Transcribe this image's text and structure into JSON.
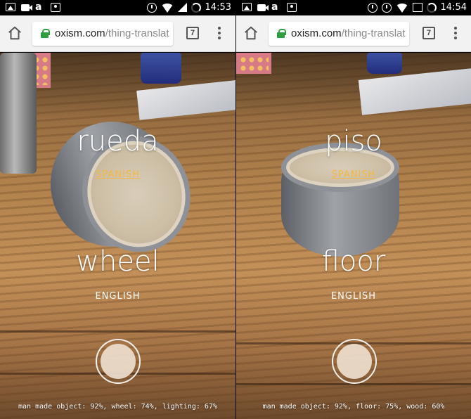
{
  "screens": [
    {
      "status": {
        "time": "14:53"
      },
      "browser": {
        "url_host": "oxism.com",
        "url_path": "/thing-translat",
        "tab_count": "7"
      },
      "translation": {
        "word": "rueda",
        "language": "SPANISH"
      },
      "source": {
        "word": "wheel",
        "language": "ENGLISH"
      },
      "predictions": "man made object: 92%, wheel: 74%, lighting: 67%"
    },
    {
      "status": {
        "time": "14:54"
      },
      "browser": {
        "url_host": "oxism.com",
        "url_path": "/thing-translat",
        "tab_count": "7"
      },
      "translation": {
        "word": "piso",
        "language": "SPANISH"
      },
      "source": {
        "word": "floor",
        "language": "ENGLISH"
      },
      "predictions": "man made object: 92%, floor: 75%, wood: 60%"
    }
  ],
  "colors": {
    "accent_language": "#f4b840",
    "lock": "#2e9e3e",
    "toolbar": "#f2f2f2"
  },
  "icons": [
    "home-icon",
    "lock-icon",
    "tabs-icon",
    "menu-icon",
    "shutter-icon"
  ]
}
